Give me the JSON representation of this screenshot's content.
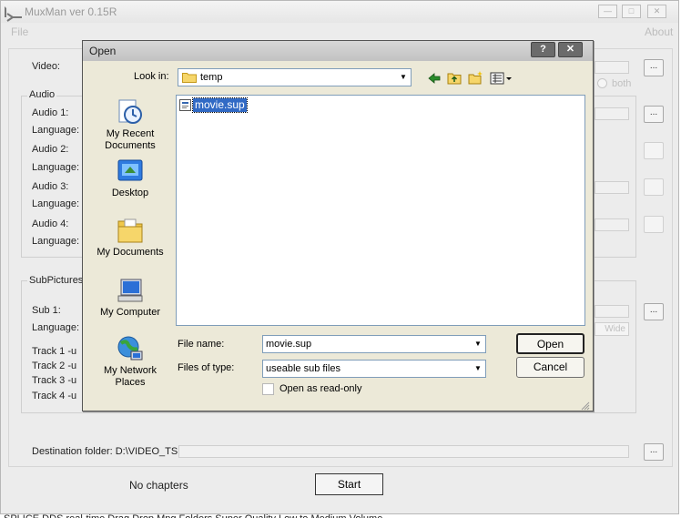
{
  "main": {
    "title": "MuxMan ver 0.15R",
    "menu": {
      "file": "File",
      "about": "About"
    },
    "video_label": "Video:",
    "audio": {
      "group": "Audio",
      "rows": [
        {
          "label": "Audio 1:",
          "language": "Language:"
        },
        {
          "label": "Audio 2:",
          "language": "Language:"
        },
        {
          "label": "Audio 3:",
          "language": "Language:"
        },
        {
          "label": "Audio 4:",
          "language": "Language:"
        }
      ],
      "both": "both"
    },
    "subpictures": {
      "group": "SubPictures",
      "sub1": "Sub 1:",
      "language": "Language:",
      "tracks": [
        "Track 1  -u",
        "Track 2  -u",
        "Track 3  -u",
        "Track 4  -u"
      ],
      "wide": "Wide"
    },
    "destination": "Destination folder: D:\\VIDEO_TS",
    "chapters": "No chapters",
    "start": "Start",
    "dots": "...",
    "status": "SPLICE DDS real-time    Drag Drop  Mpg Folders  Super  Quality  Low to Medium Volume"
  },
  "dialog": {
    "title": "Open",
    "help": "?",
    "close": "✕",
    "look_in_label": "Look in:",
    "look_in_value": "temp",
    "places": [
      {
        "name": "recent",
        "label": "My Recent Documents"
      },
      {
        "name": "desktop",
        "label": "Desktop"
      },
      {
        "name": "documents",
        "label": "My Documents"
      },
      {
        "name": "computer",
        "label": "My Computer"
      },
      {
        "name": "network",
        "label": "My Network Places"
      }
    ],
    "files": [
      {
        "name": "movie.sup"
      }
    ],
    "file_name_label": "File name:",
    "file_name_value": "movie.sup",
    "files_of_type_label": "Files of type:",
    "files_of_type_value": "useable sub files",
    "read_only_label": "Open as read-only",
    "open_button": "Open",
    "cancel_button": "Cancel"
  },
  "colors": {
    "selection": "#316ac5",
    "folder": "#f0c419",
    "dialog_bg": "#ece9d8"
  }
}
